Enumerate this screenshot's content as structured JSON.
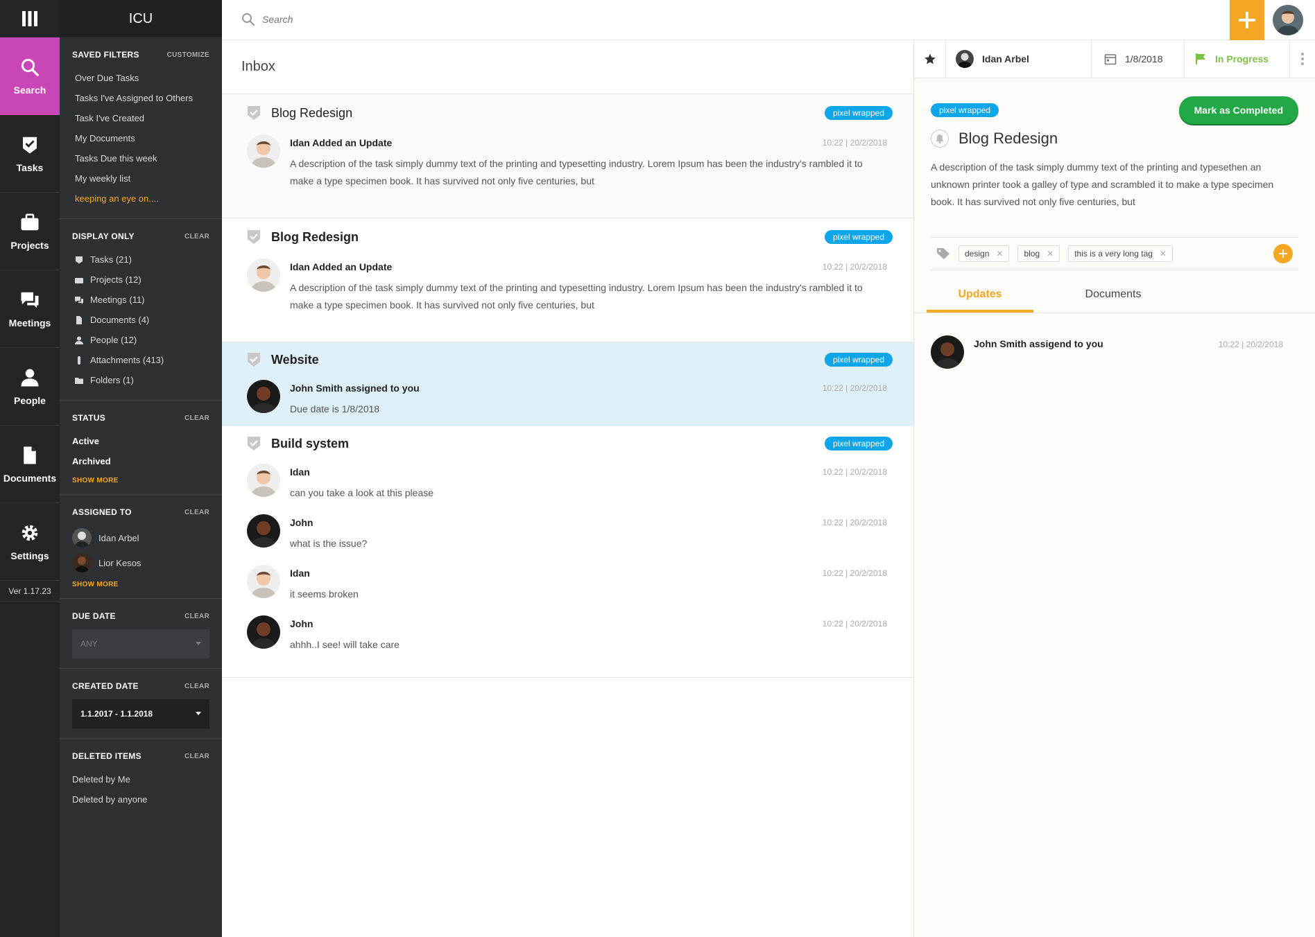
{
  "app": {
    "title": "ICU",
    "version": "Ver 1.17.23"
  },
  "rail": [
    {
      "label": "Search",
      "icon": "search-icon"
    },
    {
      "label": "Tasks",
      "icon": "tasks-icon"
    },
    {
      "label": "Projects",
      "icon": "briefcase-icon"
    },
    {
      "label": "Meetings",
      "icon": "chat-icon"
    },
    {
      "label": "People",
      "icon": "person-icon"
    },
    {
      "label": "Documents",
      "icon": "document-icon"
    },
    {
      "label": "Settings",
      "icon": "gear-icon"
    }
  ],
  "filters": {
    "saved": {
      "title": "SAVED FILTERS",
      "action": "CUSTOMIZE",
      "items": [
        "Over Due Tasks",
        "Tasks I've Assigned to Others",
        "Task I've Created",
        "My Documents",
        "Tasks Due this week",
        "My weekly list",
        "keeping an eye on...."
      ]
    },
    "display": {
      "title": "DISPLAY ONLY",
      "action": "CLEAR",
      "items": [
        "Tasks (21)",
        "Projects (12)",
        "Meetings (11)",
        "Documents (4)",
        "People (12)",
        "Attachments (413)",
        "Folders (1)"
      ]
    },
    "status": {
      "title": "STATUS",
      "action": "CLEAR",
      "items": [
        "Active",
        "Archived"
      ],
      "more": "SHOW MORE"
    },
    "assigned": {
      "title": "ASSIGNED TO",
      "action": "CLEAR",
      "people": [
        "Idan Arbel",
        "Lior Kesos"
      ],
      "more": "SHOW MORE"
    },
    "due": {
      "title": "DUE DATE",
      "action": "CLEAR",
      "value": "ANY"
    },
    "created": {
      "title": "CREATED DATE",
      "action": "CLEAR",
      "value": "1.1.2017  - 1.1.2018"
    },
    "deleted": {
      "title": "DELETED ITEMS",
      "action": "CLEAR",
      "items": [
        "Deleted by Me",
        "Deleted by anyone"
      ]
    }
  },
  "search": {
    "placeholder": "Search"
  },
  "inbox": {
    "title": "Inbox",
    "threads": [
      {
        "title": "Blog Redesign",
        "tag": "pixel wrapped",
        "messages": [
          {
            "name": "Idan Added an Update",
            "time": "10:22  |  20/2/2018",
            "text": "A description of the task  simply dummy text of the printing and typesetting industry. Lorem Ipsum has been the industry's rambled it to make a type specimen book. It has survived not only five centuries, but"
          }
        ]
      },
      {
        "title": "Blog Redesign",
        "tag": "pixel wrapped",
        "messages": [
          {
            "name": "Idan Added an Update",
            "time": "10:22  |  20/2/2018",
            "text": "A description of the task  simply dummy text of the printing and typesetting industry. Lorem Ipsum has been the industry's rambled it to make a type specimen book. It has survived not only five centuries, but"
          }
        ]
      },
      {
        "title": "Website",
        "tag": "pixel wrapped",
        "messages": [
          {
            "name": "John Smith assigned to you",
            "time": "10:22  |  20/2/2018",
            "text": "Due date is 1/8/2018"
          }
        ]
      },
      {
        "title": "Build system",
        "tag": "pixel wrapped",
        "messages": [
          {
            "name": "Idan",
            "time": "10:22  |  20/2/2018",
            "text": "can you take a look at this please"
          },
          {
            "name": "John",
            "time": "10:22  |  20/2/2018",
            "text": "what is the issue?"
          },
          {
            "name": "Idan",
            "time": "10:22  |  20/2/2018",
            "text": "it seems broken"
          },
          {
            "name": "John",
            "time": "10:22  |  20/2/2018",
            "text": "ahhh..I see! will take care"
          }
        ]
      }
    ]
  },
  "detail": {
    "owner": "Idan Arbel",
    "date": "1/8/2018",
    "status": "In Progress",
    "tag": "pixel wrapped",
    "complete_label": "Mark as Completed",
    "title": "Blog Redesign",
    "description": "A description of the task  simply dummy text of the printing and typesethen an unknown printer took a galley of type and scrambled it to make a type specimen book. It has survived not only five centuries, but",
    "tags": [
      "design",
      "blog",
      "this is a very long tag"
    ],
    "tabs": [
      "Updates",
      "Documents"
    ],
    "update": {
      "name": "John Smith assigend to you",
      "time": "10:22  |  20/2/2018"
    }
  },
  "colors": {
    "accent": "#f5a623",
    "search_active": "#c946b6",
    "tag_blue": "#0ea5e9",
    "complete_green": "#22a846",
    "status_green": "#7cc242",
    "selected_row": "#dff0f8"
  }
}
